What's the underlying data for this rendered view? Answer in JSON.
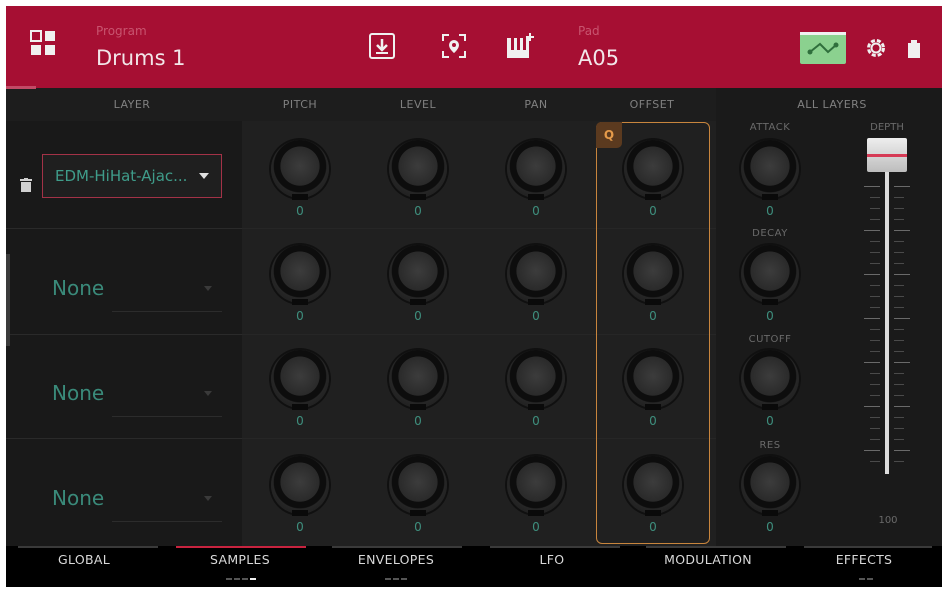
{
  "header": {
    "program_label": "Program",
    "program_name": "Drums 1",
    "pad_label": "Pad",
    "pad_name": "A05"
  },
  "columns": {
    "layer": "LAYER",
    "pitch": "PITCH",
    "level": "LEVEL",
    "pan": "PAN",
    "offset": "OFFSET",
    "all_layers": "ALL LAYERS"
  },
  "layers": [
    {
      "sample": "EDM-HiHat-Ajac...",
      "pitch": "0",
      "level": "0",
      "pan": "0",
      "offset": "0"
    },
    {
      "sample": "None",
      "pitch": "0",
      "level": "0",
      "pan": "0",
      "offset": "0"
    },
    {
      "sample": "None",
      "pitch": "0",
      "level": "0",
      "pan": "0",
      "offset": "0"
    },
    {
      "sample": "None",
      "pitch": "0",
      "level": "0",
      "pan": "0",
      "offset": "0"
    }
  ],
  "offset_badge": "Q",
  "all_layers": {
    "attack_label": "ATTACK",
    "attack": "0",
    "decay_label": "DECAY",
    "decay": "0",
    "cutoff_label": "CUTOFF",
    "cutoff": "0",
    "res_label": "RES",
    "res": "0",
    "depth_label": "DEPTH",
    "depth_value": "100"
  },
  "tabs": [
    {
      "label": "GLOBAL"
    },
    {
      "label": "SAMPLES"
    },
    {
      "label": "ENVELOPES"
    },
    {
      "label": "LFO"
    },
    {
      "label": "MODULATION"
    },
    {
      "label": "EFFECTS"
    }
  ],
  "colors": {
    "header": "#a60f33",
    "accent_teal": "#3e8f7e",
    "offset_frame": "#c8853d",
    "active_tab": "#c8233f",
    "fader_marker": "#d63a55"
  },
  "icons": [
    "grid-icon",
    "save-icon",
    "locate-icon",
    "keyboard-icon",
    "mod-routing-icon",
    "gear-icon",
    "battery-icon",
    "trash-icon"
  ]
}
